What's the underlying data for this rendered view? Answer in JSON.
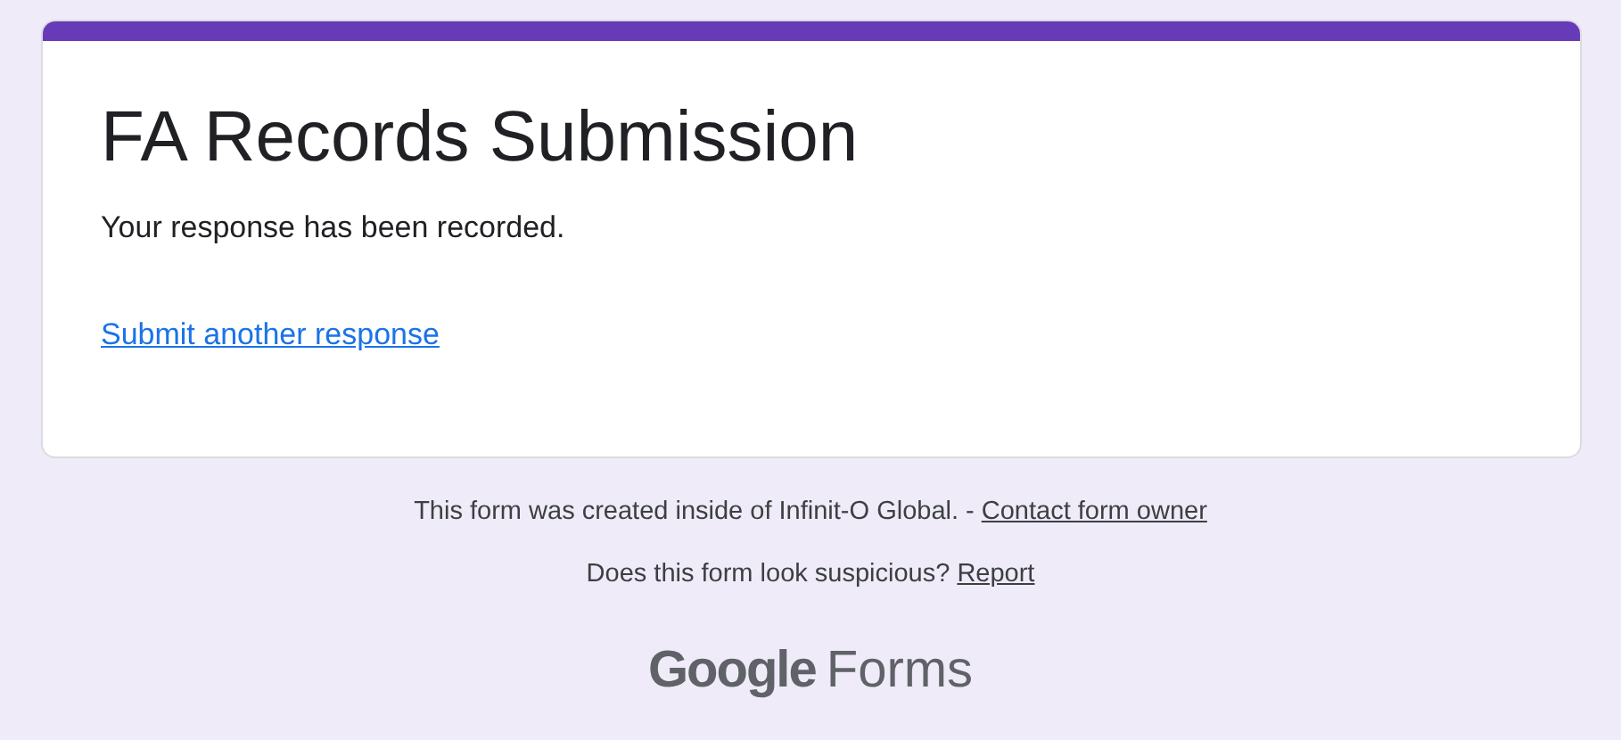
{
  "form": {
    "title": "FA Records Submission",
    "message": "Your response has been recorded.",
    "link": "Submit another response"
  },
  "footer": {
    "created_text": "This form was created inside of Infinit-O Global. -",
    "contact_link": "Contact form owner",
    "suspicious_text": "Does this form look suspicious?",
    "report_link": "Report"
  },
  "logo": {
    "brand": "Google",
    "product": "Forms"
  }
}
